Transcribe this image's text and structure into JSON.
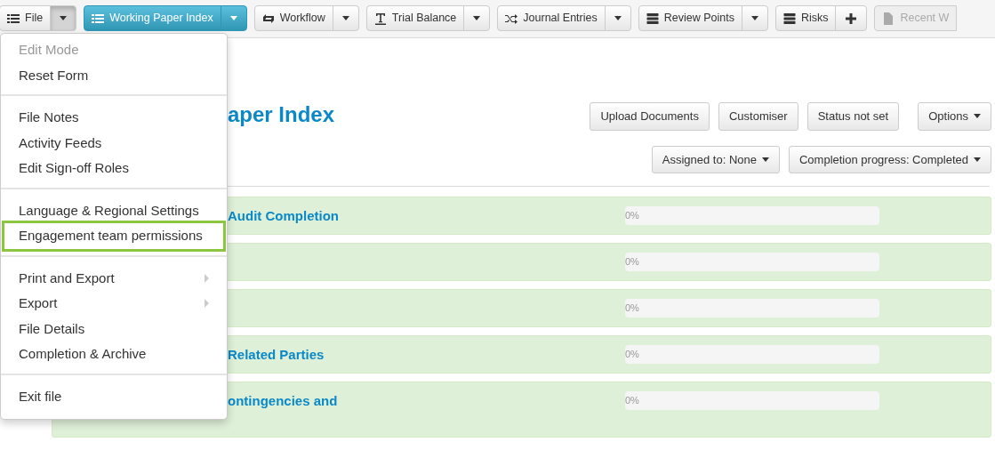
{
  "toolbar": [
    {
      "label": "File",
      "kind": "split",
      "selected": false,
      "open": true,
      "disabled": false
    },
    {
      "label": "Working Paper Index",
      "kind": "split",
      "selected": true,
      "open": false,
      "disabled": false
    },
    {
      "label": "Workflow",
      "kind": "split",
      "selected": false,
      "open": false,
      "disabled": false
    },
    {
      "label": "Trial Balance",
      "kind": "split",
      "selected": false,
      "open": false,
      "disabled": false
    },
    {
      "label": "Journal Entries",
      "kind": "split",
      "selected": false,
      "open": false,
      "disabled": false
    },
    {
      "label": "Review Points",
      "kind": "split",
      "selected": false,
      "open": false,
      "disabled": false
    },
    {
      "label": "Risks",
      "kind": "add",
      "selected": false,
      "open": false,
      "disabled": false
    },
    {
      "label": "Recent W",
      "kind": "plain",
      "selected": false,
      "open": false,
      "disabled": true
    }
  ],
  "page": {
    "title": "aper Index",
    "actions": [
      {
        "label": "Upload Documents",
        "kind": "button"
      },
      {
        "label": "Customiser",
        "kind": "button"
      },
      {
        "label": "Status not set",
        "kind": "button"
      },
      {
        "label": "Options",
        "kind": "dropdown"
      }
    ],
    "filters": [
      {
        "label": "Assigned to: None",
        "kind": "dropdown"
      },
      {
        "label": "Completion progress: Completed",
        "kind": "dropdown"
      }
    ],
    "sections": [
      {
        "title": "Audit Completion",
        "progress_text": "0%",
        "level": 0
      },
      {
        "progress_text": "0%",
        "level": 0
      },
      {
        "progress_text": "0%",
        "level": 0
      },
      {
        "title": "Related Parties",
        "progress_text": "0%",
        "level": 0
      },
      {
        "title": "ontingencies and",
        "progress_text": "0%",
        "level": 0
      }
    ]
  },
  "file_menu": {
    "groups": [
      [
        {
          "label": "Edit Mode",
          "disabled": true,
          "submenu": false,
          "highlighted": false
        },
        {
          "label": "Reset Form",
          "disabled": false,
          "submenu": false,
          "highlighted": false
        }
      ],
      [
        {
          "label": "File Notes",
          "disabled": false,
          "submenu": false,
          "highlighted": false
        },
        {
          "label": "Activity Feeds",
          "disabled": false,
          "submenu": false,
          "highlighted": false
        },
        {
          "label": "Edit Sign-off Roles",
          "disabled": false,
          "submenu": false,
          "highlighted": false
        }
      ],
      [
        {
          "label": "Language & Regional Settings",
          "disabled": false,
          "submenu": false,
          "highlighted": false
        },
        {
          "label": "Engagement team permissions",
          "disabled": false,
          "submenu": false,
          "highlighted": true
        }
      ],
      [
        {
          "label": "Print and Export",
          "disabled": false,
          "submenu": true,
          "highlighted": false
        },
        {
          "label": "Export",
          "disabled": false,
          "submenu": true,
          "highlighted": false
        },
        {
          "label": "File Details",
          "disabled": false,
          "submenu": false,
          "highlighted": false
        },
        {
          "label": "Completion & Archive",
          "disabled": false,
          "submenu": false,
          "highlighted": false
        }
      ],
      [
        {
          "label": "Exit file",
          "disabled": false,
          "submenu": false,
          "highlighted": false
        }
      ]
    ]
  }
}
